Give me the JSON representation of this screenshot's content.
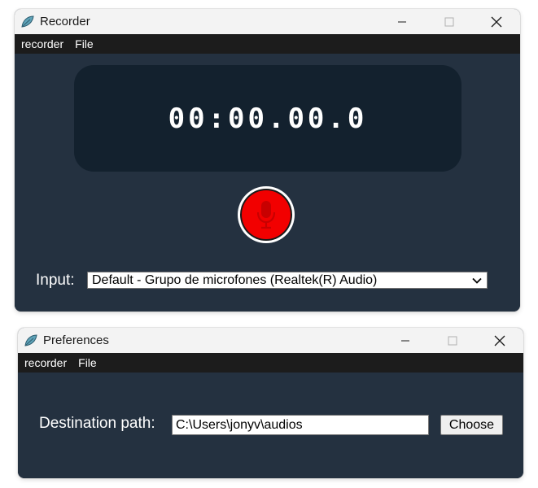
{
  "recorder_window": {
    "title": "Recorder",
    "menu": [
      "recorder",
      "File"
    ],
    "timer": "00:00.00.0",
    "record_button_color": "#f20000",
    "record_icon": "microphone-icon",
    "input_label": "Input:",
    "input_selected": "Default - Grupo de microfones (Realtek(R) Audio)"
  },
  "preferences_window": {
    "title": "Preferences",
    "menu": [
      "recorder",
      "File"
    ],
    "destination_label": "Destination path:",
    "destination_value": "C:\\Users\\jonyv\\audios",
    "choose_label": "Choose"
  },
  "theme": {
    "background": "#243140",
    "timer_panel": "#13212e",
    "menubar": "#1c1c1c",
    "titlebar": "#f3f3f3"
  }
}
